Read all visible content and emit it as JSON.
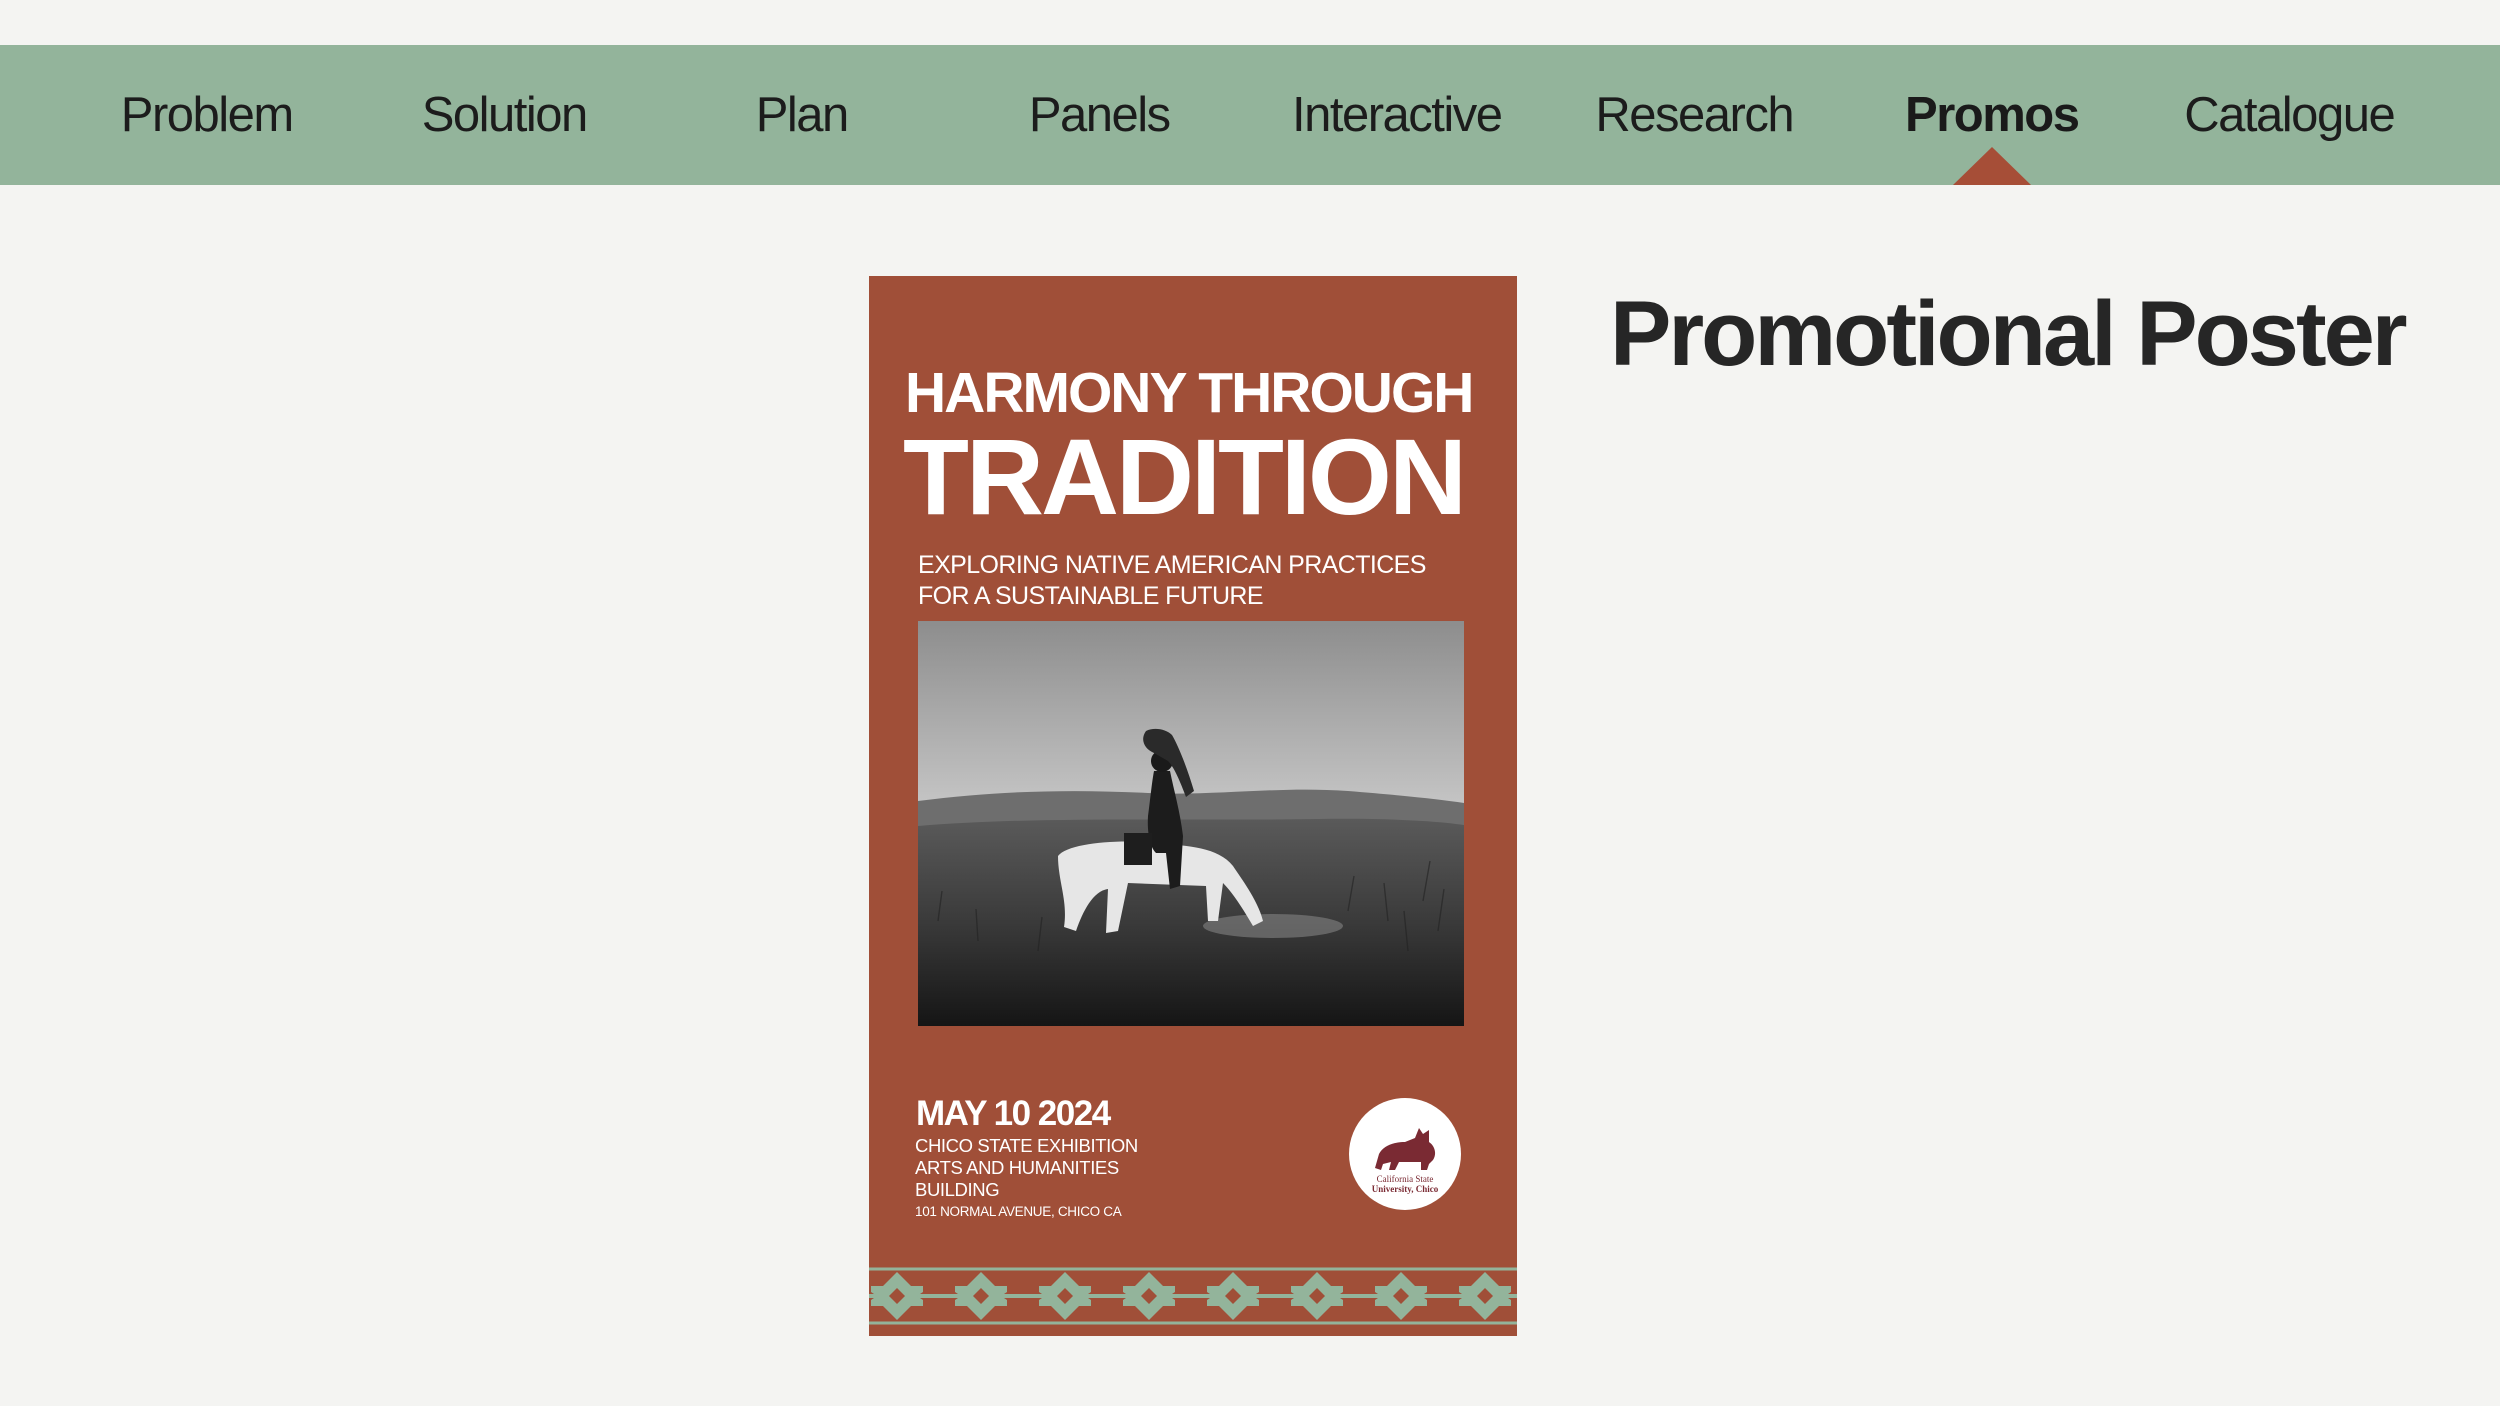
{
  "nav": {
    "items": [
      {
        "label": "Problem",
        "active": false
      },
      {
        "label": "Solution",
        "active": false
      },
      {
        "label": "Plan",
        "active": false
      },
      {
        "label": "Panels",
        "active": false
      },
      {
        "label": "Interactive",
        "active": false
      },
      {
        "label": "Research",
        "active": false
      },
      {
        "label": "Promos",
        "active": true
      },
      {
        "label": "Catalogue",
        "active": false
      }
    ]
  },
  "section": {
    "title": "Promotional Poster"
  },
  "poster": {
    "heading_small": "HARMONY THROUGH",
    "heading_large": "TRADITION",
    "subtitle_line1": "EXPLORING NATIVE AMERICAN PRACTICES",
    "subtitle_line2": "FOR A SUSTAINABLE FUTURE",
    "date": "MAY 10 2024",
    "venue_line1": "CHICO STATE EXHIBITION",
    "venue_line2": "ARTS AND HUMANITIES",
    "venue_line3": "BUILDING",
    "address": "101 NORMAL AVENUE, CHICO CA",
    "logo_line1": "California State",
    "logo_line2": "University, Chico",
    "photo_icon": "horse-rider-photo",
    "logo_icon": "wildcat-logo-icon"
  },
  "colors": {
    "nav_bg": "#93b49b",
    "active_indicator": "#a64e37",
    "poster_bg": "#a04f38",
    "page_bg": "#f4f4f2",
    "border_pattern": "#93b49b"
  }
}
